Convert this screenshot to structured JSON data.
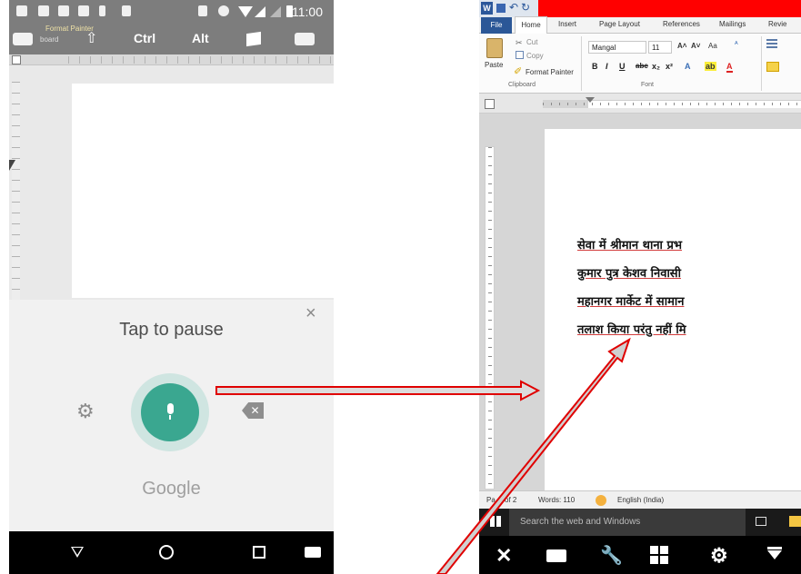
{
  "phone": {
    "status_time": "11:00",
    "kb_bar": {
      "ctrl": "Ctrl",
      "alt": "Alt",
      "ghost_format_painter": "Format Painter",
      "ghost_clipboard": "board"
    },
    "voice": {
      "tap_to_pause": "Tap to pause",
      "google": "Google",
      "close": "×",
      "settings_icon": "⚙",
      "backspace_icon": "✕"
    },
    "nav": {
      "back_icon": "back-icon",
      "home_icon": "home-icon",
      "recent_icon": "recent-apps-icon",
      "keyboard_icon": "keyboard-icon"
    }
  },
  "word": {
    "tabs": [
      "File",
      "Home",
      "Insert",
      "Page Layout",
      "References",
      "Mailings",
      "Revie"
    ],
    "clipboard": {
      "cut": "Cut",
      "copy": "Copy",
      "format_painter": "Format Painter",
      "paste": "Paste",
      "group_label": "Clipboard"
    },
    "font": {
      "name": "Mangal",
      "size": "11",
      "group_label": "Font",
      "grow": "A˄",
      "shrink": "A˅",
      "case": "Aa",
      "bold": "B",
      "italic": "I",
      "underline": "U",
      "strike": "abc",
      "subscript": "x₂",
      "superscript": "x²"
    },
    "document_lines": [
      "सेवा में श्रीमान थाना प्रभ",
      "कुमार पुत्र केशव निवासी",
      "महानगर मार्केट में सामान",
      "तलाश किया परंतु नहीं मि"
    ],
    "statusbar": {
      "page": "Pa",
      "page_of": "of 2",
      "words": "Words: 110",
      "language": "English (India)"
    },
    "taskbar": {
      "search_placeholder": "Search the web and Windows"
    },
    "bottom_bar": {
      "close": "✕",
      "tools": "🔧",
      "settings": "⚙"
    }
  },
  "colors": {
    "accent_red": "#ff0000",
    "mic_green": "#3aa790",
    "word_blue": "#2b579a"
  }
}
